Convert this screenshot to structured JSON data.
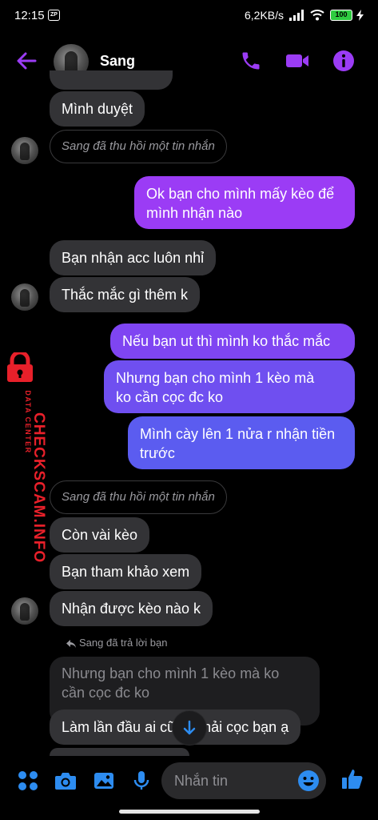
{
  "status_bar": {
    "time": "12:15",
    "app_badge": "ZP",
    "speed": "6,2KB/s",
    "battery": "100"
  },
  "header": {
    "contact_name": "Sang",
    "accent_color": "#9b3cf5"
  },
  "messages": [
    {
      "type": "in",
      "text": "Mình duyệt"
    },
    {
      "type": "recall",
      "text": "Sang đã thu hồi một tin nhắn"
    },
    {
      "type": "out",
      "lines": [
        "Ok bạn cho mình mấy kèo để",
        "mình nhận nào"
      ]
    },
    {
      "type": "in",
      "text": "Bạn nhận acc luôn nhỉ"
    },
    {
      "type": "in",
      "text": "Thắc mắc gì thêm k"
    },
    {
      "type": "out",
      "text": "Nếu bạn ut thì mình ko thắc mắc"
    },
    {
      "type": "out",
      "lines": [
        "Nhưng bạn cho mình 1 kèo mà",
        "ko cần cọc đc ko"
      ]
    },
    {
      "type": "out",
      "lines": [
        "Mình cày lên 1 nửa r nhận tiền",
        "trước"
      ]
    },
    {
      "type": "recall",
      "text": "Sang đã thu hồi một tin nhắn"
    },
    {
      "type": "in",
      "text": "Còn vài kèo"
    },
    {
      "type": "in",
      "text": "Bạn tham khảo xem"
    },
    {
      "type": "in",
      "text": "Nhận được kèo nào k"
    }
  ],
  "reply": {
    "label": "Sang đã trả lời bạn",
    "quoted_lines": [
      "Nhưng bạn cho mình 1 kèo mà ko",
      "cần cọc đc ko"
    ],
    "message": "Làm lần đầu ai cũng phải cọc bạn ạ"
  },
  "watermark": {
    "main": "CHECKSCAM.INFO",
    "sub": "DATA CENTER"
  },
  "composer": {
    "placeholder": "Nhắn tin"
  },
  "colors": {
    "bubble_out_top": "#9b3cf5",
    "bubble_out_bottom": "#5b5cf0",
    "bubble_in": "#333336",
    "icon_blue": "#2d8cf0"
  }
}
